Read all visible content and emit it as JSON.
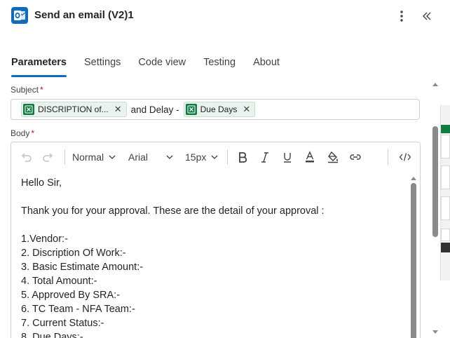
{
  "header": {
    "title": "Send an email (V2)1",
    "icon": "outlook-icon",
    "accent": "#0f6cbd"
  },
  "tabs": [
    {
      "label": "Parameters",
      "active": true
    },
    {
      "label": "Settings",
      "active": false
    },
    {
      "label": "Code view",
      "active": false
    },
    {
      "label": "Testing",
      "active": false
    },
    {
      "label": "About",
      "active": false
    }
  ],
  "subject": {
    "label": "Subject",
    "required_mark": "*",
    "token1": "DISCRIPTION of...",
    "text": "and Delay -",
    "token2": "Due Days",
    "token_color": "#107c41"
  },
  "body": {
    "label": "Body",
    "required_mark": "*",
    "toolbar": {
      "style": "Normal",
      "font": "Arial",
      "size": "15px"
    },
    "lines": [
      "Hello Sir,",
      "",
      "Thank you for your approval. These are the detail of your approval :",
      "",
      "1.Vendor:-",
      "2. Discription Of Work:-",
      "3. Basic Estimate Amount:-",
      "4. Total Amount:-",
      "5. Approved By SRA:-",
      "6. TC Team - NFA Team:-",
      "7. Current Status:-",
      "8. Due Days:-"
    ]
  }
}
